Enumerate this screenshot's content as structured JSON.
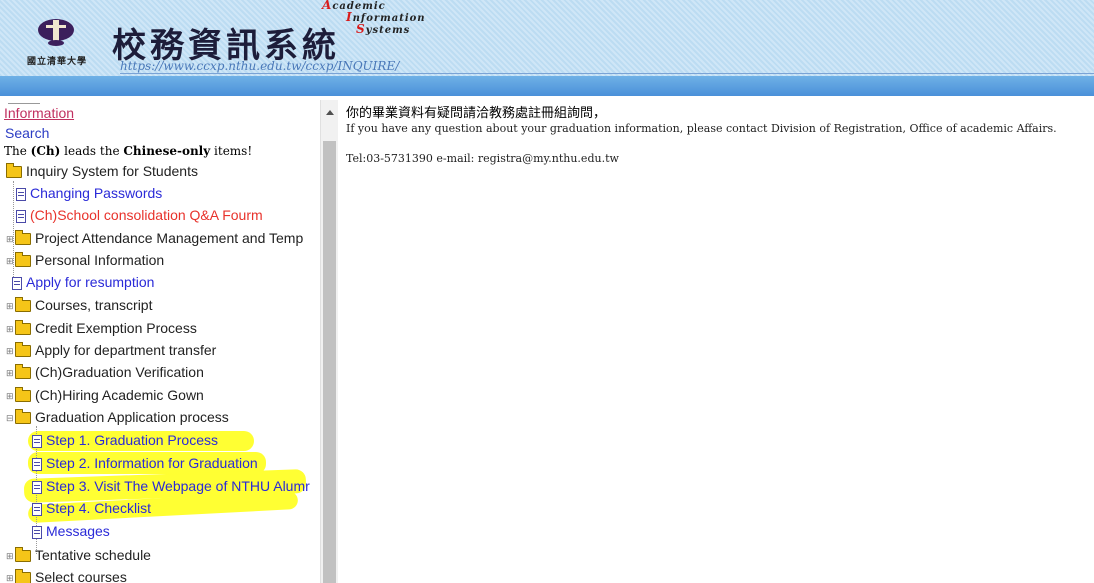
{
  "banner": {
    "university_name": "國立清華大學",
    "system_title_cn": "校務資訊系統",
    "system_title_en": [
      "Academic",
      "Information",
      "Systems"
    ],
    "system_url": "https://www.ccxp.nthu.edu.tw/ccxp/INQUIRE/",
    "band_color": "#4a90d9"
  },
  "sidebar": {
    "information_link": "Information",
    "search_link": "Search",
    "note_prefix": "The",
    "note_ch": "(Ch)",
    "note_mid": "leads the",
    "note_bold": "Chinese-only",
    "note_suffix": "items!",
    "items": [
      {
        "label": "Inquiry System for Students",
        "icon": "open-folder-icon"
      },
      {
        "label": "Changing Passwords",
        "icon": "document-icon"
      },
      {
        "label": "(Ch)School consolidation Q&A Fourm",
        "icon": "document-icon"
      },
      {
        "label": "Project Attendance Management and Temp",
        "icon": "folder-icon"
      },
      {
        "label": "Personal Information",
        "icon": "folder-icon"
      },
      {
        "label": "Apply for resumption",
        "icon": "document-icon"
      },
      {
        "label": "Courses, transcript",
        "icon": "folder-icon"
      },
      {
        "label": "Credit Exemption Process",
        "icon": "folder-icon"
      },
      {
        "label": "Apply for department transfer",
        "icon": "folder-icon"
      },
      {
        "label": "(Ch)Graduation Verification",
        "icon": "folder-icon"
      },
      {
        "label": "(Ch)Hiring Academic Gown",
        "icon": "folder-icon"
      },
      {
        "label": "Graduation Application process",
        "icon": "open-folder-icon"
      },
      {
        "label": "Step 1. Graduation Process",
        "icon": "document-icon"
      },
      {
        "label": "Step 2. Information for Graduation",
        "icon": "document-icon"
      },
      {
        "label": "Step 3. Visit The Webpage of NTHU Alumr",
        "icon": "document-icon"
      },
      {
        "label": "Step 4. Checklist",
        "icon": "document-icon"
      },
      {
        "label": "Messages",
        "icon": "document-icon"
      },
      {
        "label": "Tentative schedule",
        "icon": "folder-icon"
      },
      {
        "label": "Select courses",
        "icon": "folder-icon"
      }
    ],
    "highlight_color": "#ffff33"
  },
  "main": {
    "cn_line": "你的畢業資料有疑問請洽教務處註冊組詢問，",
    "en_line": "If you have any question about your graduation information, please contact Division of Registration, Office of academic Affairs.",
    "tel_line": "Tel:03-5731390 e-mail: registra@my.nthu.edu.tw"
  }
}
